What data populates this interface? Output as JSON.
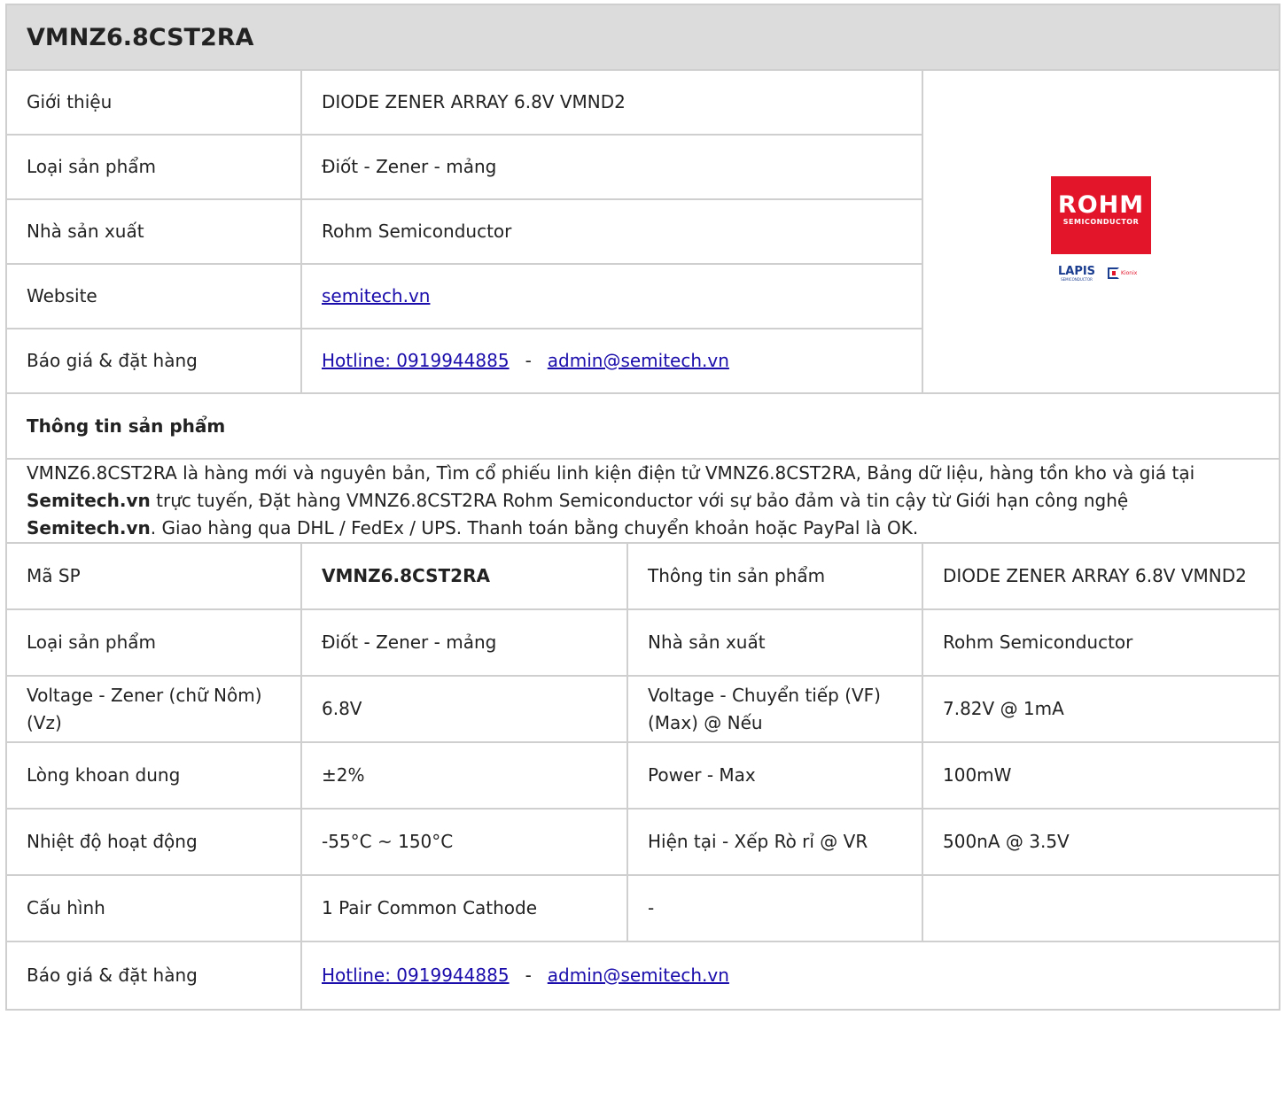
{
  "title": "VMNZ6.8CST2RA",
  "summary": {
    "rows": [
      {
        "label": "Giới thiệu",
        "value": "DIODE ZENER ARRAY 6.8V VMND2"
      },
      {
        "label": "Loại sản phẩm",
        "value": "Điốt - Zener - mảng"
      },
      {
        "label": "Nhà sản xuất",
        "value": "Rohm Semiconductor"
      },
      {
        "label": "Website",
        "link": "semitech.vn"
      },
      {
        "label": "Báo giá & đặt hàng",
        "hotline": "Hotline: 0919944885",
        "separator": "-",
        "email": "admin@semitech.vn"
      }
    ],
    "logo": {
      "brand": "ROHM",
      "brand_sub": "SEMICONDUCTOR",
      "lapis": "LAPIS",
      "lapis_sub": "SEMICONDUCTOR",
      "kionix": "Kionix",
      "icon": "kionix-logo-icon"
    }
  },
  "section_title": "Thông tin sản phẩm",
  "description": {
    "p1": "VMNZ6.8CST2RA là hàng mới và nguyên bản, Tìm cổ phiếu linh kiện điện tử VMNZ6.8CST2RA, Bảng dữ liệu, hàng tồn kho và giá tại ",
    "b1": "Semitech.vn",
    "p2": " trực tuyến, Đặt hàng VMNZ6.8CST2RA Rohm Semiconductor với sự bảo đảm và tin cậy từ Giới hạn công nghệ ",
    "b2": "Semitech.vn",
    "p3": ". Giao hàng qua DHL / FedEx / UPS. Thanh toán bằng chuyển khoản hoặc PayPal là OK."
  },
  "specs": [
    {
      "l1": "Mã SP",
      "v1": "VMNZ6.8CST2RA",
      "l2": "Thông tin sản phẩm",
      "v2": "DIODE ZENER ARRAY 6.8V VMND2"
    },
    {
      "l1": "Loại sản phẩm",
      "v1": "Điốt - Zener - mảng",
      "l2": "Nhà sản xuất",
      "v2": "Rohm Semiconductor"
    },
    {
      "l1": "Voltage - Zener (chữ Nôm) (Vz)",
      "v1": "6.8V",
      "l2": "Voltage - Chuyển tiếp (VF) (Max) @ Nếu",
      "v2": "7.82V @ 1mA"
    },
    {
      "l1": "Lòng khoan dung",
      "v1": "±2%",
      "l2": "Power - Max",
      "v2": "100mW"
    },
    {
      "l1": "Nhiệt độ hoạt động",
      "v1": "-55°C ~ 150°C",
      "l2": "Hiện tại - Xếp Rò rỉ @ VR",
      "v2": "500nA @ 3.5V"
    },
    {
      "l1": "Cấu hình",
      "v1": "1 Pair Common Cathode",
      "l2": "-",
      "v2": ""
    }
  ],
  "order": {
    "label": "Báo giá & đặt hàng",
    "hotline": "Hotline: 0919944885",
    "separator": "-",
    "email": "admin@semitech.vn"
  },
  "colors": {
    "link": "#1a0dab",
    "header_bg": "#dcdcdc",
    "border": "#cfcfcf",
    "brand_red": "#e3152b",
    "lapis_blue": "#1b3d8f"
  }
}
